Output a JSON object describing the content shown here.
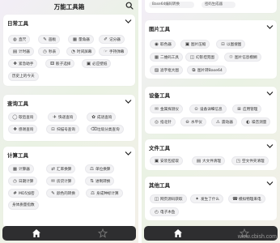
{
  "app_title": "万能工具箱",
  "left": {
    "daily": {
      "title": "日常工具",
      "items": [
        {
          "icon": "◍",
          "label": "直尺"
        },
        {
          "icon": "✎",
          "label": "画板"
        },
        {
          "icon": "▦",
          "label": "量角器"
        },
        {
          "icon": "✐",
          "label": "记分器"
        },
        {
          "icon": "▤",
          "label": "计时器"
        },
        {
          "icon": "◷",
          "label": "秒表"
        },
        {
          "icon": "◔",
          "label": "时间屏幕"
        },
        {
          "icon": "☞",
          "label": "手持弹幕"
        },
        {
          "icon": "✚",
          "label": "紧急助手"
        },
        {
          "icon": "⚅",
          "label": "骰子选择"
        },
        {
          "icon": "▣",
          "label": "必应壁纸"
        },
        {
          "icon": "",
          "label": "历史上的今天"
        }
      ]
    },
    "query": {
      "title": "查询工具",
      "items": [
        {
          "icon": "◯",
          "label": "歇后查询"
        },
        {
          "icon": "✈",
          "label": "快递查询"
        },
        {
          "icon": "✿",
          "label": "成语查询"
        },
        {
          "icon": "✚",
          "label": "感谢查询"
        },
        {
          "icon": "⊡",
          "label": "扫描号查询"
        },
        {
          "icon": "⌫",
          "label": "垃圾分类查询"
        }
      ]
    },
    "calc": {
      "title": "计算工具",
      "items": [
        {
          "icon": "▦",
          "label": "计算器"
        },
        {
          "icon": "⇄",
          "label": "汇率换算"
        },
        {
          "icon": "⚖",
          "label": "单位换算"
        },
        {
          "icon": "◷",
          "label": "日期计算"
        },
        {
          "icon": "✉",
          "label": "房贷计算"
        },
        {
          "icon": "⇅",
          "label": "进制转换"
        },
        {
          "icon": "#",
          "label": "MD5加密"
        },
        {
          "icon": "✎",
          "label": "颜色的转换"
        },
        {
          "icon": "⚖",
          "label": "身成种标计算"
        },
        {
          "icon": "",
          "label": "身体质量指数"
        }
      ]
    }
  },
  "right": {
    "clip": [
      {
        "label": "Base64编码转换"
      },
      {
        "label": "密码生成器"
      }
    ],
    "image": {
      "title": "图片工具",
      "items": [
        {
          "icon": "◉",
          "label": "取色器"
        },
        {
          "icon": "▣",
          "label": "图片压缩"
        },
        {
          "icon": "⊡",
          "label": "以图搜图"
        },
        {
          "icon": "▦",
          "label": "二维码工具"
        },
        {
          "icon": "◫",
          "label": "幻影坦克图"
        },
        {
          "icon": "☉",
          "label": "图片信息模糊"
        },
        {
          "icon": "▨",
          "label": "滤字抠大图"
        },
        {
          "icon": "⧉",
          "label": "图片转Base64"
        }
      ]
    },
    "device": {
      "title": "设备工具",
      "items": [
        {
          "icon": "✉",
          "label": "金属探测仪"
        },
        {
          "icon": "⊙",
          "label": "设备详细信息"
        },
        {
          "icon": "⊞",
          "label": "应用管理"
        },
        {
          "icon": "◎",
          "label": "指北针"
        },
        {
          "icon": "⊖",
          "label": "水平仪"
        },
        {
          "icon": "⚠",
          "label": "震动器"
        },
        {
          "icon": "◐",
          "label": "噪音测量"
        }
      ]
    },
    "file": {
      "title": "文件工具",
      "items": [
        {
          "icon": "▣",
          "label": "安装包提取"
        },
        {
          "icon": "▤",
          "label": "大文件清理"
        },
        {
          "icon": "◳",
          "label": "空文件夹清理"
        }
      ]
    },
    "other": {
      "title": "其他工具",
      "items": [
        {
          "icon": "◫",
          "label": "网页源码获取"
        },
        {
          "icon": "✦",
          "label": "发生了什么"
        },
        {
          "icon": "☎",
          "label": "模拟物理来电"
        },
        {
          "icon": "◴",
          "label": "电子木鱼"
        }
      ]
    }
  },
  "watermark": "www.cbish.com"
}
